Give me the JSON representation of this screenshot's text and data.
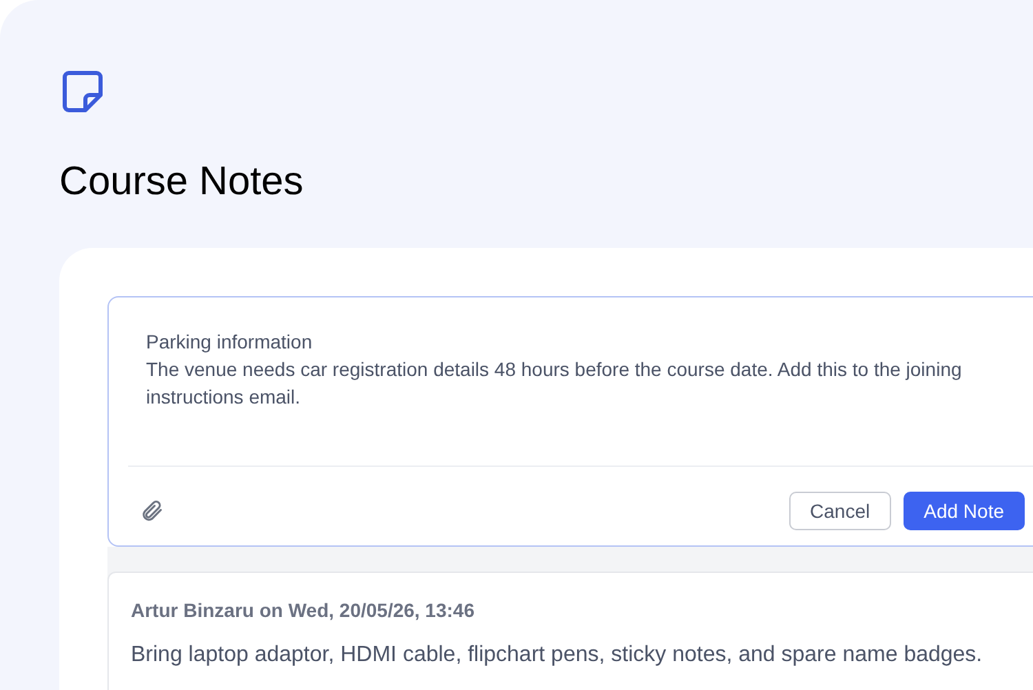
{
  "header": {
    "title": "Course Notes"
  },
  "composer": {
    "value": "Parking information\nThe venue needs car registration details 48 hours before the course date. Add this to the joining instructions email.",
    "buttons": [
      {
        "label": "Cancel",
        "kind": "secondary"
      },
      {
        "label": "Add Note",
        "kind": "primary"
      }
    ]
  },
  "notes": [
    {
      "meta": "Artur Binzaru on Wed, 20/05/26, 13:46",
      "text": "Bring laptop adaptor, HDMI cable, flipchart pens, sticky notes, and spare name badges."
    }
  ]
}
